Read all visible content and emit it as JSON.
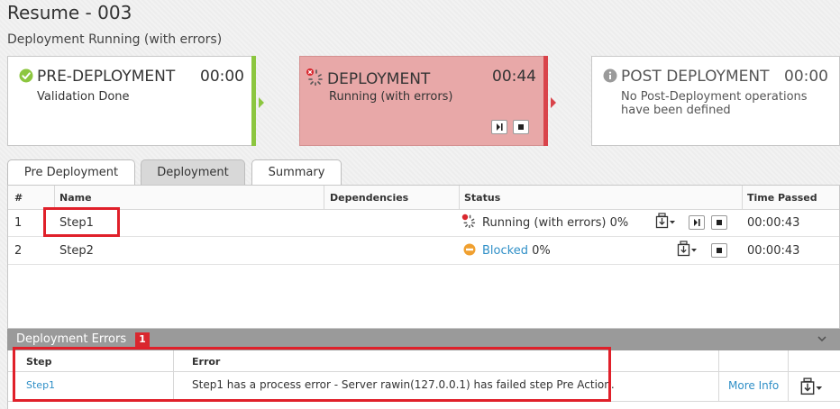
{
  "page": {
    "title": "Resume - 003",
    "subtitle": "Deployment Running (with errors)"
  },
  "phases": {
    "pre": {
      "name": "PRE-DEPLOYMENT",
      "time": "00:00",
      "desc": "Validation Done",
      "icon": "check-circle-icon"
    },
    "dep": {
      "name": "DEPLOYMENT",
      "time": "00:44",
      "desc": "Running (with errors)",
      "icon": "spinner-error-icon"
    },
    "post": {
      "name": "POST DEPLOYMENT",
      "time": "00:00",
      "desc": "No Post-Deployment operations have been defined",
      "icon": "info-circle-icon"
    }
  },
  "tabs": [
    {
      "label": "Pre Deployment"
    },
    {
      "label": "Deployment"
    },
    {
      "label": "Summary"
    }
  ],
  "grid": {
    "headers": {
      "num": "#",
      "name": "Name",
      "deps": "Dependencies",
      "status": "Status",
      "time": "Time Passed"
    },
    "rows": [
      {
        "num": "1",
        "name": "Step1",
        "status": "Running (with errors)",
        "percent": "0%",
        "time": "00:00:43"
      },
      {
        "num": "2",
        "name": "Step2",
        "status": "Blocked",
        "percent": "0%",
        "time": "00:00:43"
      }
    ]
  },
  "errors": {
    "title": "Deployment Errors",
    "count": "1",
    "headers": {
      "step": "Step",
      "error": "Error"
    },
    "rows": [
      {
        "step": "Step1",
        "error": "Step1 has a process error - Server rawin(127.0.0.1) has failed step Pre Action.",
        "more": "More Info"
      }
    ]
  },
  "colors": {
    "green": "#8cc63f",
    "red": "#d9434a",
    "pink": "#e8a8a8",
    "link": "#2f8fc7",
    "blocked": "#f0a030",
    "badge": "#d9272e"
  }
}
